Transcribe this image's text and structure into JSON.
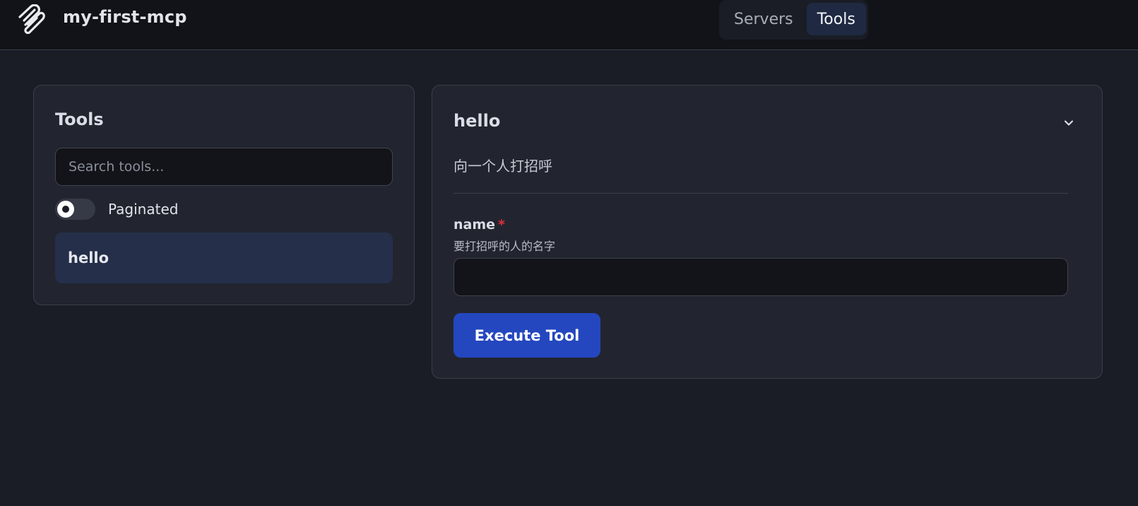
{
  "header": {
    "app_title": "my-first-mcp",
    "logo_icon": "paperclip-icon",
    "tabs": [
      {
        "label": "Servers",
        "active": false
      },
      {
        "label": "Tools",
        "active": true
      }
    ]
  },
  "tools_panel": {
    "heading": "Tools",
    "search": {
      "value": "",
      "placeholder": "Search tools..."
    },
    "paginated": {
      "label": "Paginated",
      "enabled": false
    },
    "items": [
      {
        "label": "hello",
        "selected": true
      }
    ]
  },
  "tool_detail": {
    "name": "hello",
    "description": "向一个人打招呼",
    "collapse_icon": "chevron-down-icon",
    "params": [
      {
        "name": "name",
        "required_mark": "*",
        "description": "要打招呼的人的名字",
        "value": ""
      }
    ],
    "execute_label": "Execute Tool"
  },
  "colors": {
    "background": "#1a1d26",
    "header_bg": "#111318",
    "card_bg": "#22252f",
    "accent": "#2447bf",
    "selected_item": "#252f4a",
    "required": "#e2303a"
  }
}
